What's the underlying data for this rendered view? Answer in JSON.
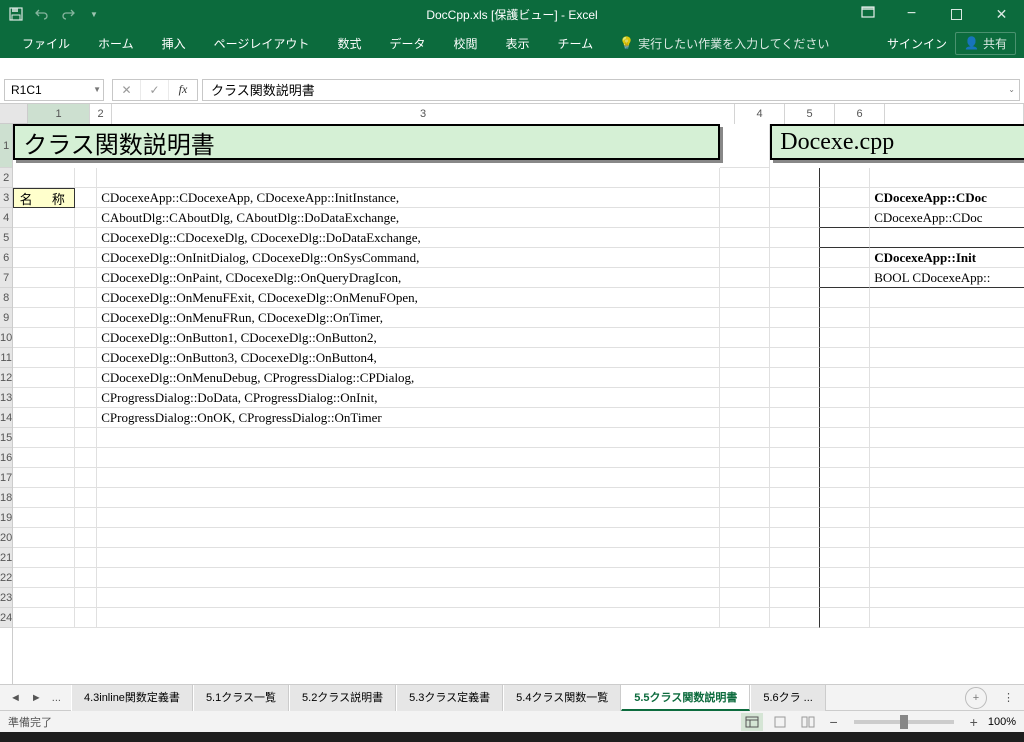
{
  "app_title": "DocCpp.xls [保護ビュー] - Excel",
  "qat": {
    "save": "保存",
    "undo": "元に戻す",
    "redo": "やり直し"
  },
  "window": {
    "geom": "⬜",
    "minimize": "—",
    "maximize": "❐",
    "close": "✕"
  },
  "ribbon": {
    "tabs": [
      "ファイル",
      "ホーム",
      "挿入",
      "ページレイアウト",
      "数式",
      "データ",
      "校閲",
      "表示",
      "チーム"
    ],
    "tell_me": "実行したい作業を入力してください",
    "signin": "サインイン",
    "share": "共有"
  },
  "name_box": "R1C1",
  "formula_bar": "クラス関数説明書",
  "columns": [
    1,
    2,
    3,
    4,
    5,
    6
  ],
  "row_numbers": [
    1,
    2,
    3,
    4,
    5,
    6,
    7,
    8,
    9,
    10,
    11,
    12,
    13,
    14,
    15,
    16,
    17,
    18,
    19,
    20,
    21,
    22,
    23,
    24
  ],
  "title_cells": {
    "left": "クラス関数説明書",
    "right": "Docexe.cpp"
  },
  "name_label": "名 称",
  "data_rows": [
    "CDocexeApp::CDocexeApp, CDocexeApp::InitInstance,",
    "CAboutDlg::CAboutDlg, CAboutDlg::DoDataExchange,",
    "CDocexeDlg::CDocexeDlg, CDocexeDlg::DoDataExchange,",
    "CDocexeDlg::OnInitDialog, CDocexeDlg::OnSysCommand,",
    "CDocexeDlg::OnPaint, CDocexeDlg::OnQueryDragIcon,",
    "CDocexeDlg::OnMenuFExit, CDocexeDlg::OnMenuFOpen,",
    "CDocexeDlg::OnMenuFRun, CDocexeDlg::OnTimer,",
    "CDocexeDlg::OnButton1, CDocexeDlg::OnButton2,",
    "CDocexeDlg::OnButton3, CDocexeDlg::OnButton4,",
    "CDocexeDlg::OnMenuDebug, CProgressDialog::CPDialog,",
    "CProgressDialog::DoData, CProgressDialog::OnInit,",
    "CProgressDialog::OnOK, CProgressDialog::OnTimer"
  ],
  "right_rows": {
    "r3": "CDocexeApp::CDoc",
    "r4": "CDocexeApp::CDoc",
    "r6": "CDocexeApp::Init",
    "r7": "BOOL CDocexeApp::"
  },
  "sheet_tabs": [
    "4.3inline関数定義書",
    "5.1クラス一覧",
    "5.2クラス説明書",
    "5.3クラス定義書",
    "5.4クラス関数一覧",
    "5.5クラス関数説明書",
    "5.6クラ ..."
  ],
  "active_tab_index": 5,
  "status": {
    "ready": "準備完了",
    "zoom": "100%"
  }
}
